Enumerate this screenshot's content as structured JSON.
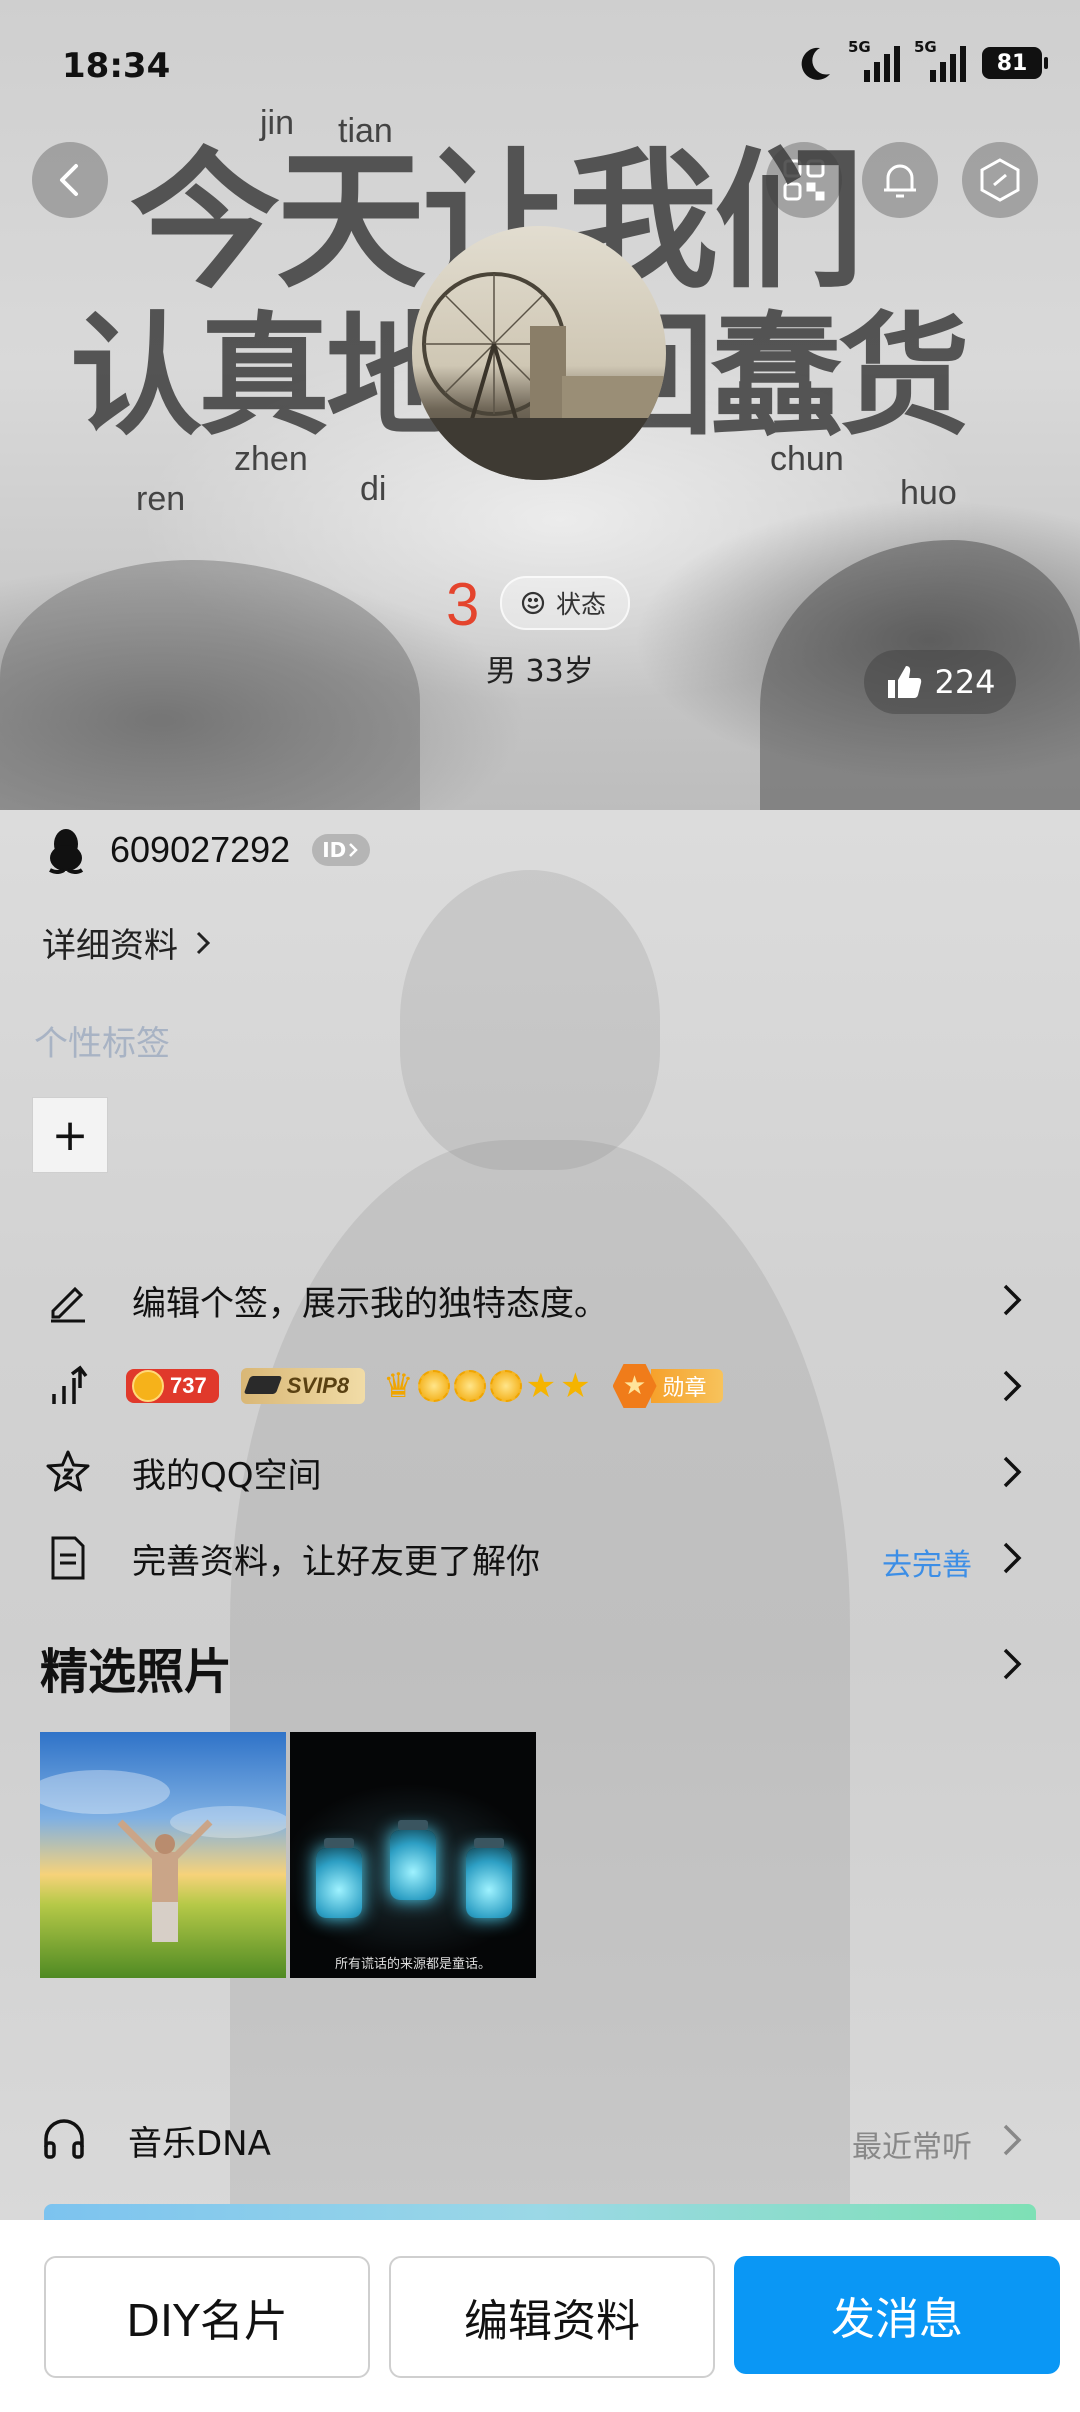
{
  "status_bar": {
    "time": "18:34",
    "network_1": "5G",
    "network_2": "5G",
    "battery": "81"
  },
  "header": {
    "back_icon": "chevron-left-icon",
    "qr_icon": "qr-code-icon",
    "bell_icon": "bell-icon",
    "more_icon": "hexagon-menu-icon"
  },
  "cover_art": {
    "line1": "今天让我们",
    "line2": "认真地做回蠢货",
    "pinyin": [
      "jin",
      "tian",
      "ren",
      "zhen",
      "di",
      "chun",
      "huo"
    ]
  },
  "profile": {
    "nickname": "3",
    "status_label": "状态",
    "gender_age": "男 33岁",
    "likes": "224",
    "qq_number": "609027292",
    "id_badge": "ID",
    "detail_label": "详细资料",
    "tags_title": "个性标签",
    "add_tag": "+"
  },
  "rows": {
    "signature": "编辑个签，展示我的独特态度。",
    "level_value": "737",
    "svip": "SVIP8",
    "medal": "勋章",
    "qzone": "我的QQ空间",
    "complete": "完善资料，让好友更了解你",
    "complete_link": "去完善"
  },
  "photos": {
    "title": "精选照片",
    "caption_2": "所有谎话的来源都是童话。"
  },
  "music": {
    "label": "音乐DNA",
    "link": "最近常听"
  },
  "bottom": {
    "diy": "DIY名片",
    "edit": "编辑资料",
    "message": "发消息"
  },
  "colors": {
    "accent": "#0a97f5",
    "nickname": "#e4442d",
    "link": "#3c8ee6"
  }
}
